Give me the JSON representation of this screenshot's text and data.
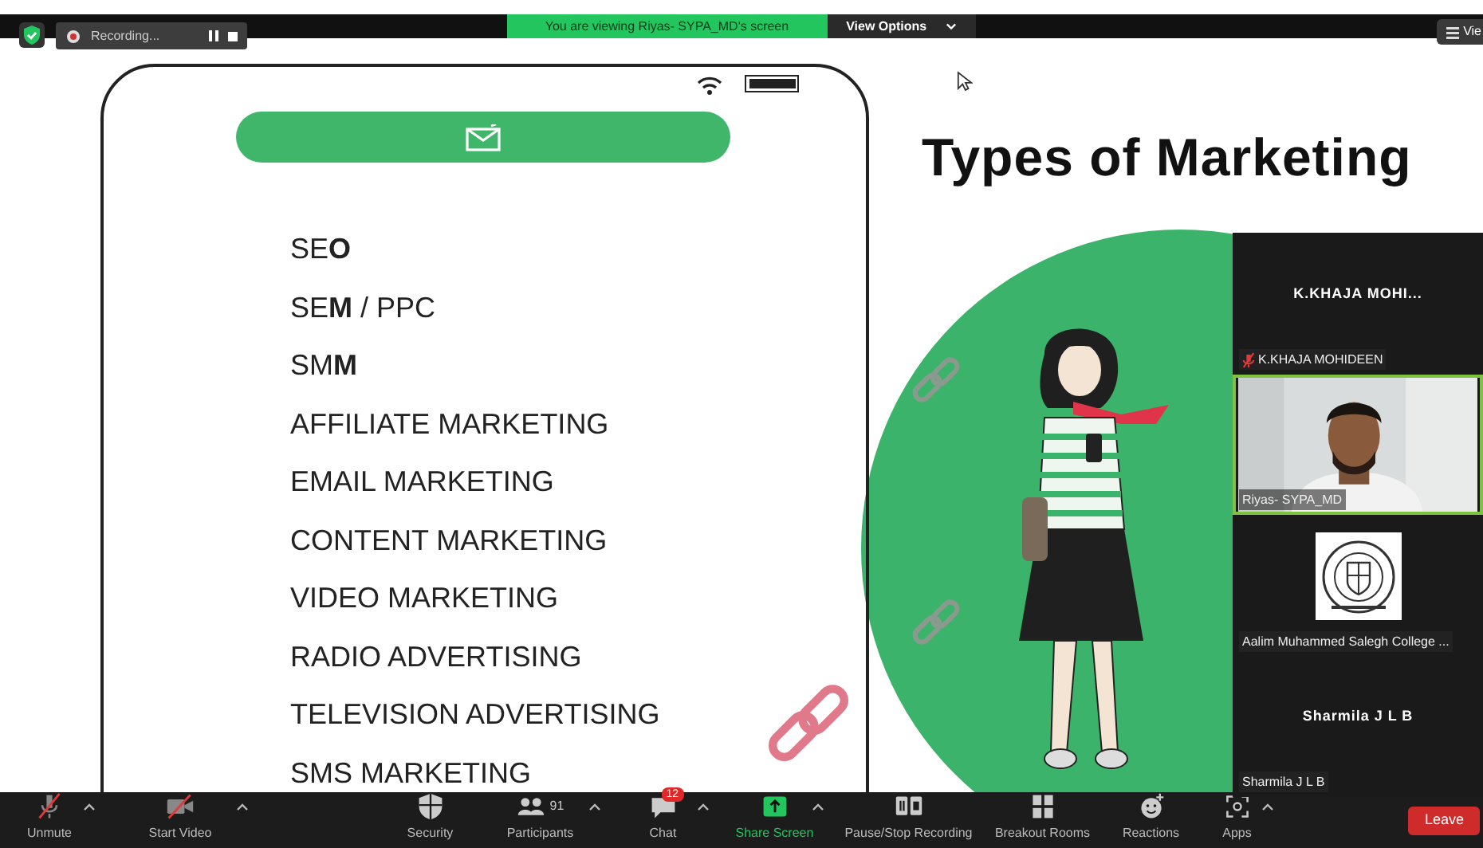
{
  "top_bar": {
    "recording": {
      "label": "Recording..."
    },
    "banner": "You are viewing Riyas- SYPA_MD's screen",
    "view_options": "View Options",
    "view": "Vie"
  },
  "slide": {
    "title": "Types of Marketing",
    "items": [
      "SE**O**",
      "SE**M** / PPC",
      "SM**M**",
      "AFFILIATE MARKETING",
      "EMAIL MARKETING",
      "CONTENT MARKETING",
      "VIDEO MARKETING",
      "RADIO ADVERTISING",
      "TELEVISION ADVERTISING",
      "SMS MARKETING"
    ]
  },
  "participants": [
    {
      "kind": "name",
      "name": "K.KHAJA MOHI...",
      "label": "K.KHAJA MOHIDEEN",
      "muted": true,
      "speaking": false
    },
    {
      "kind": "video",
      "label": "Riyas- SYPA_MD",
      "muted": false,
      "speaking": true
    },
    {
      "kind": "logo",
      "label": "Aalim Muhammed Salegh College ...",
      "muted": false,
      "speaking": false
    },
    {
      "kind": "name",
      "name": "Sharmila J L B",
      "label": "Sharmila J L B",
      "muted": false,
      "speaking": false
    }
  ],
  "toolbar": [
    {
      "kind": "mic",
      "label": "Unmute",
      "caret": true,
      "highlighted": false
    },
    {
      "kind": "video",
      "label": "Start Video",
      "caret": true,
      "highlighted": false
    },
    {
      "kind": "security",
      "label": "Security",
      "caret": false,
      "highlighted": false
    },
    {
      "kind": "participants",
      "label": "Participants",
      "count": "91",
      "caret": true,
      "highlighted": false
    },
    {
      "kind": "chat",
      "label": "Chat",
      "badge": "12",
      "caret": true,
      "highlighted": false
    },
    {
      "kind": "share",
      "label": "Share Screen",
      "caret": true,
      "highlighted": true
    },
    {
      "kind": "record",
      "label": "Pause/Stop Recording",
      "caret": false,
      "highlighted": false
    },
    {
      "kind": "breakout",
      "label": "Breakout Rooms",
      "caret": false,
      "highlighted": false
    },
    {
      "kind": "reactions",
      "label": "Reactions",
      "caret": false,
      "highlighted": false
    },
    {
      "kind": "apps",
      "label": "Apps",
      "caret": true,
      "highlighted": false
    }
  ],
  "leave": "Leave"
}
